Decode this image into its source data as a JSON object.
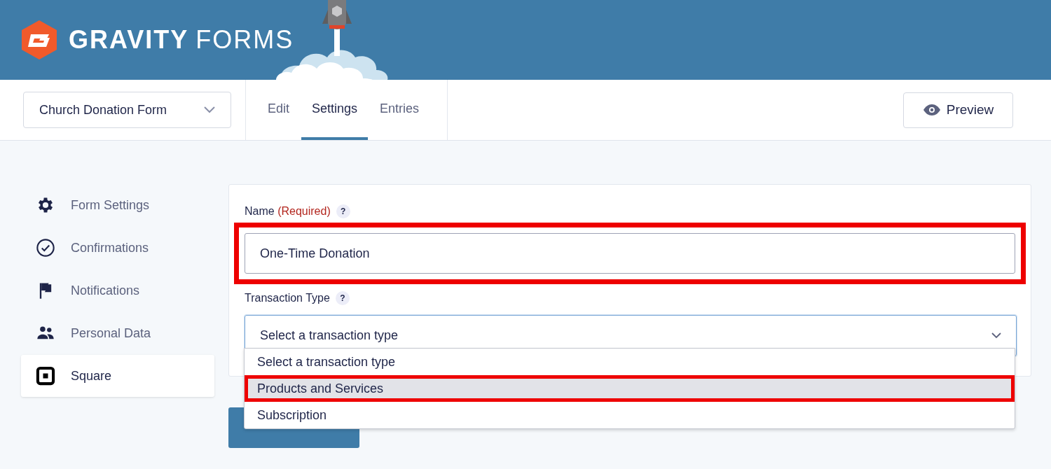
{
  "logo": {
    "bold": "GRAVITY",
    "light": "FORMS"
  },
  "form_selector": {
    "value": "Church Donation Form"
  },
  "tabs": [
    {
      "label": "Edit",
      "selected": false
    },
    {
      "label": "Settings",
      "selected": true
    },
    {
      "label": "Entries",
      "selected": false
    }
  ],
  "preview_button": "Preview",
  "sidebar": {
    "items": [
      {
        "label": "Form Settings",
        "selected": false
      },
      {
        "label": "Confirmations",
        "selected": false
      },
      {
        "label": "Notifications",
        "selected": false
      },
      {
        "label": "Personal Data",
        "selected": false
      },
      {
        "label": "Square",
        "selected": true
      }
    ]
  },
  "fields": {
    "name": {
      "label": "Name",
      "required": "(Required)",
      "help": "?",
      "value": "One-Time Donation",
      "highlighted": true
    },
    "transaction_type": {
      "label": "Transaction Type",
      "help": "?",
      "value": "Select a transaction type",
      "expanded": true,
      "options": [
        {
          "label": "Select a transaction type",
          "hovered": false,
          "highlighted": false
        },
        {
          "label": "Products and Services",
          "hovered": true,
          "highlighted": true
        },
        {
          "label": "Subscription",
          "hovered": false,
          "highlighted": false
        }
      ]
    }
  }
}
